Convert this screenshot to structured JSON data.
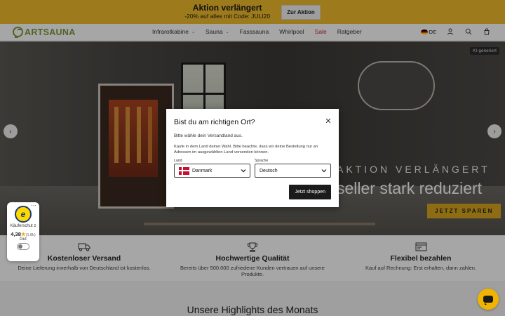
{
  "promo": {
    "title": "Aktion verlängert",
    "subtitle": "-20% auf alles mit Code: JULI20",
    "button_label": "Zur Aktion"
  },
  "header": {
    "logo_text": "ARTSAUNA",
    "nav": [
      {
        "label": "Infrarotkabine",
        "has_dropdown": true
      },
      {
        "label": "Sauna",
        "has_dropdown": true
      },
      {
        "label": "Fasssauna",
        "has_dropdown": false
      },
      {
        "label": "Whirlpool",
        "has_dropdown": false
      },
      {
        "label": "Sale",
        "has_dropdown": false
      },
      {
        "label": "Ratgeber",
        "has_dropdown": false
      }
    ],
    "language": "DE",
    "icons": [
      "germany-flag-icon",
      "user-icon",
      "search-icon",
      "cart-icon"
    ],
    "sale_color": "#c62828"
  },
  "hero": {
    "ai_tag": "KI-generiert",
    "kicker": "AKTION VERLÄNGERT",
    "headline": "seller stark reduziert",
    "cta": "JETZT SPAREN",
    "accent_color": "#d9a61e"
  },
  "features": [
    {
      "icon": "truck-icon",
      "title": "Kostenloser Versand",
      "text": "Deine Lieferung innerhalb von Deutschland ist kostenlos."
    },
    {
      "icon": "trophy-icon",
      "title": "Hochwertige Qualität",
      "text": "Bereits über 500.000 zufriedene Kunden vertrauen auf unsere Produkte."
    },
    {
      "icon": "payment-icon",
      "title": "Flexibel bezahlen",
      "text": "Kauf auf Rechnung: Erst erhalten, dann zahlen."
    }
  ],
  "highlights": {
    "title": "Unsere Highlights des Monats"
  },
  "trust_badge": {
    "logo_letter": "e",
    "label": "Käuferschut z",
    "score": "4,38",
    "count": "(1.8k)",
    "grade": "Gut"
  },
  "modal": {
    "title": "Bist du am richtigen Ort?",
    "subtitle": "Bitte wähle dein Versandland aus.",
    "note": "Kaufe in dem Land deiner Wahl. Bitte beachte, dass wir deine Bestellung nur an Adressen im ausgewählten Land versenden können.",
    "country_label": "Land",
    "country_value": "Danmark",
    "language_label": "Sprache",
    "language_value": "Deutsch",
    "submit_label": "Jetzt shoppen"
  },
  "chat": {
    "icon": "chat-icon",
    "color": "#f0b400"
  }
}
